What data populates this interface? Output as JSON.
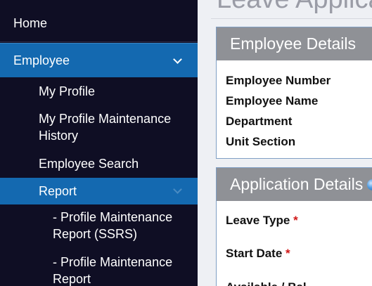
{
  "page": {
    "title": "Leave Applica"
  },
  "sidebar": {
    "home": "Home",
    "employee": "Employee",
    "employee_children": {
      "my_profile": "My Profile",
      "maintenance_history_line1": "My Profile Maintenance",
      "maintenance_history_line2": "History",
      "employee_search": "Employee Search",
      "report": "Report"
    },
    "report_children": {
      "ssrs_line1": "- Profile Maintenance",
      "ssrs_line2": "Report (SSRS)",
      "report_line1": "- Profile Maintenance",
      "report_line2": "Report"
    }
  },
  "employee_details": {
    "header": "Employee Details",
    "fields": [
      "Employee Number",
      "Employee Name",
      "Department",
      "Unit Section"
    ]
  },
  "application_details": {
    "header": "Application Details",
    "leave_type": "Leave Type",
    "start_date": "Start Date",
    "available_balance": "Available / Bal",
    "required_marker": "*"
  },
  "colors": {
    "sidebar_bg": "#0f0e24",
    "active_bg": "#1469b0",
    "panel_header_bg": "#8f9196",
    "required": "#d01818"
  }
}
